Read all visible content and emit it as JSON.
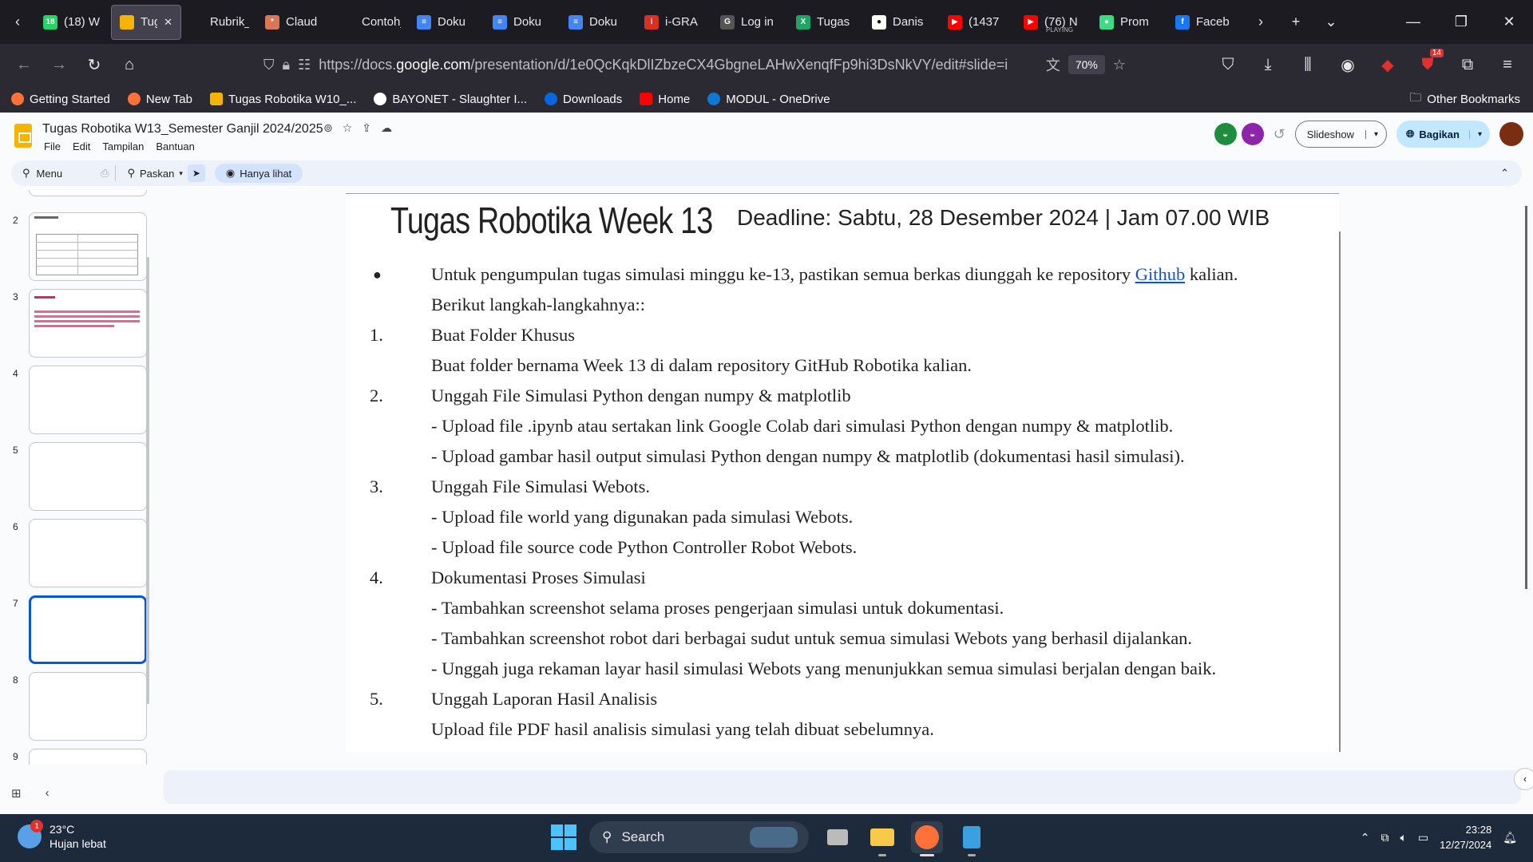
{
  "browser": {
    "tabs": [
      {
        "label": "(18) W",
        "color": "#25d366",
        "glyph": "18"
      },
      {
        "label": "Tug",
        "color": "#f4b400",
        "glyph": "",
        "active": true
      },
      {
        "label": "Rubrik_Pe",
        "color": "",
        "glyph": ""
      },
      {
        "label": "Claud",
        "color": "#d97757",
        "glyph": "*"
      },
      {
        "label": "Contoh_C",
        "color": "",
        "glyph": ""
      },
      {
        "label": "Doku",
        "color": "#4285f4",
        "glyph": "≡"
      },
      {
        "label": "Doku",
        "color": "#4285f4",
        "glyph": "≡"
      },
      {
        "label": "Doku",
        "color": "#4285f4",
        "glyph": "≡"
      },
      {
        "label": "i-GRA",
        "color": "#d93025",
        "glyph": "i"
      },
      {
        "label": "Log in",
        "color": "#555",
        "glyph": "G"
      },
      {
        "label": "Tugas",
        "color": "#21a366",
        "glyph": "X"
      },
      {
        "label": "Danis",
        "color": "#fff",
        "glyph": "●"
      },
      {
        "label": "(1437",
        "color": "#ff0000",
        "glyph": "▶"
      },
      {
        "label": "(76) N",
        "color": "#ff0000",
        "glyph": "▶",
        "sub": "PLAYING"
      },
      {
        "label": "Prom",
        "color": "#3ddc84",
        "glyph": "●"
      },
      {
        "label": "Faceb",
        "color": "#1877f2",
        "glyph": "f"
      }
    ],
    "url_prefix": "https://docs.",
    "url_host": "google.com",
    "url_rest": "/presentation/d/1e0QcKqkDlIZbzeCX4GbgneLAHwXenqfFp9hi3DsNkVY/edit#slide=i",
    "zoom": "70%",
    "bookmarks": [
      "Getting Started",
      "New Tab",
      "Tugas Robotika W10_...",
      "BAYONET - Slaughter I...",
      "Downloads",
      "Home",
      "MODUL - OneDrive"
    ],
    "other_bookmarks": "Other Bookmarks",
    "extension_badge": "14"
  },
  "slides_app": {
    "doc_title": "Tugas Robotika W13_Semester Ganjil 2024/2025",
    "menus": [
      "File",
      "Edit",
      "Tampilan",
      "Bantuan"
    ],
    "slideshow_label": "Slideshow",
    "share_label": "Bagikan",
    "toolbar": {
      "menu_label": "Menu",
      "fit_label": "Paskan",
      "view_only_label": "Hanya lihat"
    }
  },
  "filmstrip": {
    "numbers": [
      "2",
      "3",
      "4",
      "5",
      "6",
      "7",
      "8",
      "9"
    ],
    "selected": "7"
  },
  "slide": {
    "title": "Tugas Robotika Week 13",
    "deadline": "Deadline: Sabtu, 28 Desember 2024  | Jam 07.00 WIB",
    "lines": [
      {
        "marker": "●",
        "pre": "Untuk pengumpulan tugas simulasi minggu ke-13, pastikan semua berkas diunggah ke repository ",
        "link": "Github",
        "post": " kalian."
      },
      {
        "marker": "",
        "text": "Berikut langkah-langkahnya::"
      },
      {
        "marker": "1.",
        "text": "Buat Folder Khusus"
      },
      {
        "marker": "",
        "text": "Buat folder bernama Week 13 di dalam repository GitHub Robotika kalian."
      },
      {
        "marker": "2.",
        "text": "Unggah File Simulasi Python dengan numpy & matplotlib"
      },
      {
        "marker": "",
        "text": "- Upload file .ipynb atau sertakan link Google Colab dari simulasi Python dengan numpy & matplotlib."
      },
      {
        "marker": "",
        "text": "- Upload gambar hasil output simulasi Python dengan numpy & matplotlib (dokumentasi hasil simulasi)."
      },
      {
        "marker": "3.",
        "text": "Unggah File Simulasi Webots."
      },
      {
        "marker": "",
        "text": "- Upload file world yang digunakan pada simulasi Webots."
      },
      {
        "marker": "",
        "text": "- Upload file source code Python Controller Robot Webots."
      },
      {
        "marker": "4.",
        "text": "Dokumentasi Proses Simulasi"
      },
      {
        "marker": "",
        "text": "- Tambahkan screenshot selama proses pengerjaan simulasi untuk dokumentasi."
      },
      {
        "marker": "",
        "text": "- Tambahkan screenshot robot dari berbagai sudut untuk semua simulasi Webots yang berhasil dijalankan."
      },
      {
        "marker": "",
        "text": "- Unggah juga rekaman layar hasil simulasi Webots yang menunjukkan semua simulasi berjalan dengan baik."
      },
      {
        "marker": "5.",
        "text": "Unggah Laporan Hasil Analisis"
      },
      {
        "marker": "",
        "text": "Upload file PDF hasil analisis simulasi yang telah dibuat sebelumnya."
      }
    ]
  },
  "taskbar": {
    "temperature": "23°C",
    "weather": "Hujan lebat",
    "weather_badge": "1",
    "search_label": "Search",
    "time": "23:28",
    "date": "12/27/2024"
  }
}
